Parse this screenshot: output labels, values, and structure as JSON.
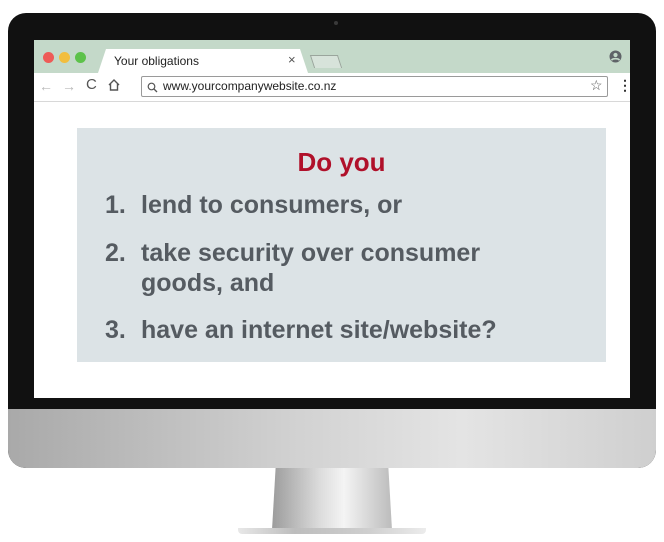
{
  "browser": {
    "tab_title": "Your obligations",
    "tab_close": "×",
    "url": "www.yourcompanywebsite.co.nz",
    "nav": {
      "back": "←",
      "forward": "→",
      "reload": "C",
      "star": "☆",
      "menu": "⋮"
    }
  },
  "content": {
    "heading": "Do you",
    "items": [
      {
        "number": "1.",
        "text": "lend to consumers, or"
      },
      {
        "number": "2.",
        "text": "take security over consumer",
        "continuation": "goods, and"
      },
      {
        "number": "3.",
        "text": "have an internet site/website?"
      }
    ]
  },
  "colors": {
    "tabbar": "#c4d9c9",
    "heading": "#b0102a",
    "body_text": "#555b61",
    "card_bg": "#dce3e6"
  }
}
